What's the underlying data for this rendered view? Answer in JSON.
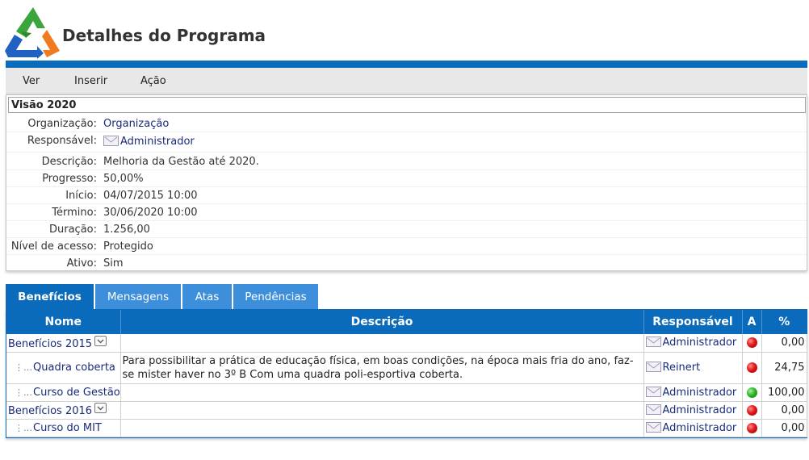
{
  "header": {
    "title": "Detalhes do Programa"
  },
  "colors": {
    "primary": "#0a6bbd",
    "tab": "#3d8fdc",
    "link": "#1a2a7a",
    "status_red": "#e01a1a",
    "status_green": "#2fb82a"
  },
  "menu": {
    "items": [
      "Ver",
      "Inserir",
      "Ação"
    ]
  },
  "details": {
    "title": "Visão 2020",
    "rows": [
      {
        "label": "Organização:",
        "value": "Organização",
        "link": true
      },
      {
        "label": "Responsável:",
        "value": "Administrador",
        "link": true,
        "icon": "mail-icon"
      },
      {
        "label": "Descrição:",
        "value": "Melhoria da Gestão até 2020."
      },
      {
        "label": "Progresso:",
        "value": "50,00%"
      },
      {
        "label": "Início:",
        "value": "04/07/2015 10:00"
      },
      {
        "label": "Término:",
        "value": "30/06/2020 10:00"
      },
      {
        "label": "Duração:",
        "value": "1.256,00"
      },
      {
        "label": "Nível de acesso:",
        "value": "Protegido"
      },
      {
        "label": "Ativo:",
        "value": "Sim"
      }
    ]
  },
  "tabs": [
    "Benefícios",
    "Mensagens",
    "Atas",
    "Pendências"
  ],
  "table": {
    "headers": [
      "Nome",
      "Descrição",
      "Responsável",
      "A",
      "%"
    ],
    "rows": [
      {
        "name": "Benefícios 2015",
        "child": false,
        "dropdown": true,
        "description": "",
        "responsible": "Administrador",
        "status": "red",
        "percent": "0,00"
      },
      {
        "name": "Quadra coberta",
        "child": true,
        "dropdown": false,
        "description": "Para possibilitar a prática de educação física, em boas condições, na época mais fria do ano, faz-se mister haver no 3º B Com uma quadra poli-esportiva coberta.",
        "responsible": "Reinert",
        "status": "red",
        "percent": "24,75"
      },
      {
        "name": "Curso de Gestão",
        "child": true,
        "dropdown": false,
        "description": "",
        "responsible": "Administrador",
        "status": "green",
        "percent": "100,00"
      },
      {
        "name": "Benefícios 2016",
        "child": false,
        "dropdown": true,
        "description": "",
        "responsible": "Administrador",
        "status": "red",
        "percent": "0,00"
      },
      {
        "name": "Curso do MIT",
        "child": true,
        "dropdown": false,
        "description": "",
        "responsible": "Administrador",
        "status": "red",
        "percent": "0,00"
      }
    ]
  }
}
